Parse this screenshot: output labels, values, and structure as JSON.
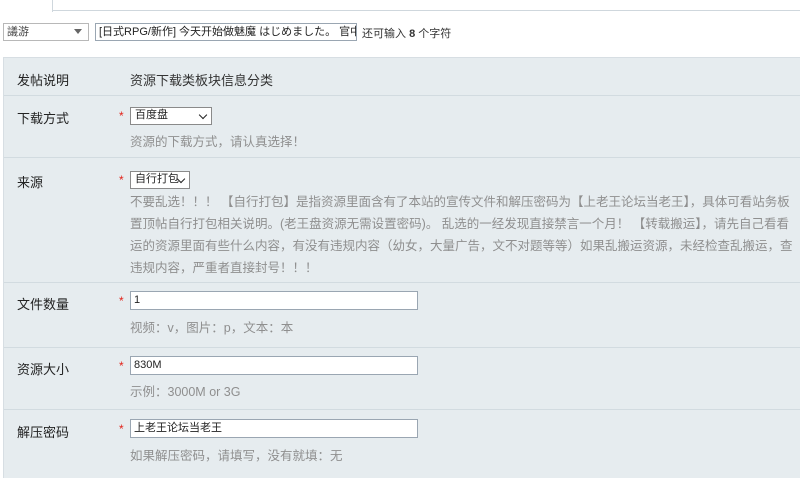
{
  "type_select": {
    "value": "議游"
  },
  "title_input": {
    "value": "[日式RPG/新作] 今天开始做魅魔 はじめました。 官中版"
  },
  "title_hint": {
    "prefix": "还可输入",
    "count": "8",
    "suffix": "个字符"
  },
  "form": {
    "description": {
      "label": "发帖说明",
      "text": "资源下载类板块信息分类"
    },
    "download_method": {
      "label": "下载方式",
      "required_mark": "*",
      "selected": "百度盘",
      "hint": "资源的下载方式，请认真选择！"
    },
    "source": {
      "label": "来源",
      "required_mark": "*",
      "selected": "自行打包",
      "lines": [
        "不要乱选！！！ 【自行打包】是指资源里面含有了本站的宣传文件和解压密码为【上老王论坛当老王】，具体可看站务板",
        "置顶帖自行打包相关说明。(老王盘资源无需设置密码)。 乱选的一经发现直接禁言一个月！ 【转载搬运】，请先自己看看",
        "运的资源里面有些什么内容，有没有违规内容（幼女，大量广告，文不对题等等）如果乱搬运资源，未经检查乱搬运，查",
        "违规内容，严重者直接封号！！！"
      ]
    },
    "file_count": {
      "label": "文件数量",
      "required_mark": "*",
      "value": "1",
      "hint": "视频：v，图片：p，文本：本"
    },
    "resource_size": {
      "label": "资源大小",
      "required_mark": "*",
      "value": "830M",
      "hint": "示例：3000M or 3G"
    },
    "unzip_password": {
      "label": "解压密码",
      "required_mark": "*",
      "value": "上老王论坛当老王",
      "hint": "如果解压密码，请填写，没有就填：无"
    }
  }
}
